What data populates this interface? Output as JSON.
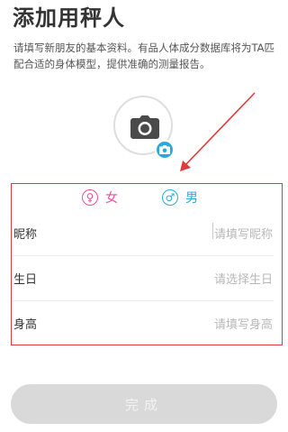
{
  "header": {
    "title": "添加用秤人",
    "description": "请填写新朋友的基本资料。有品人体成分数据库将为TA匹配合适的身体模型，提供准确的测量报告。"
  },
  "avatar": {
    "icon": "camera-icon",
    "badge_icon": "camera-small-icon"
  },
  "gender": {
    "female": {
      "symbol": "♀",
      "label": "女",
      "color": "#e8509a"
    },
    "male": {
      "symbol": "♂",
      "label": "男",
      "color": "#2aa9e0"
    }
  },
  "form": {
    "nickname": {
      "label": "昵称",
      "placeholder": "请填写昵称"
    },
    "birthday": {
      "label": "生日",
      "placeholder": "请选择生日"
    },
    "height": {
      "label": "身高",
      "placeholder": "请填写身高"
    }
  },
  "submit": {
    "label": "完成"
  },
  "colors": {
    "highlight": "#e23a3a",
    "accent": "#2aa9e0",
    "button_disabled": "#d9d9d9"
  }
}
